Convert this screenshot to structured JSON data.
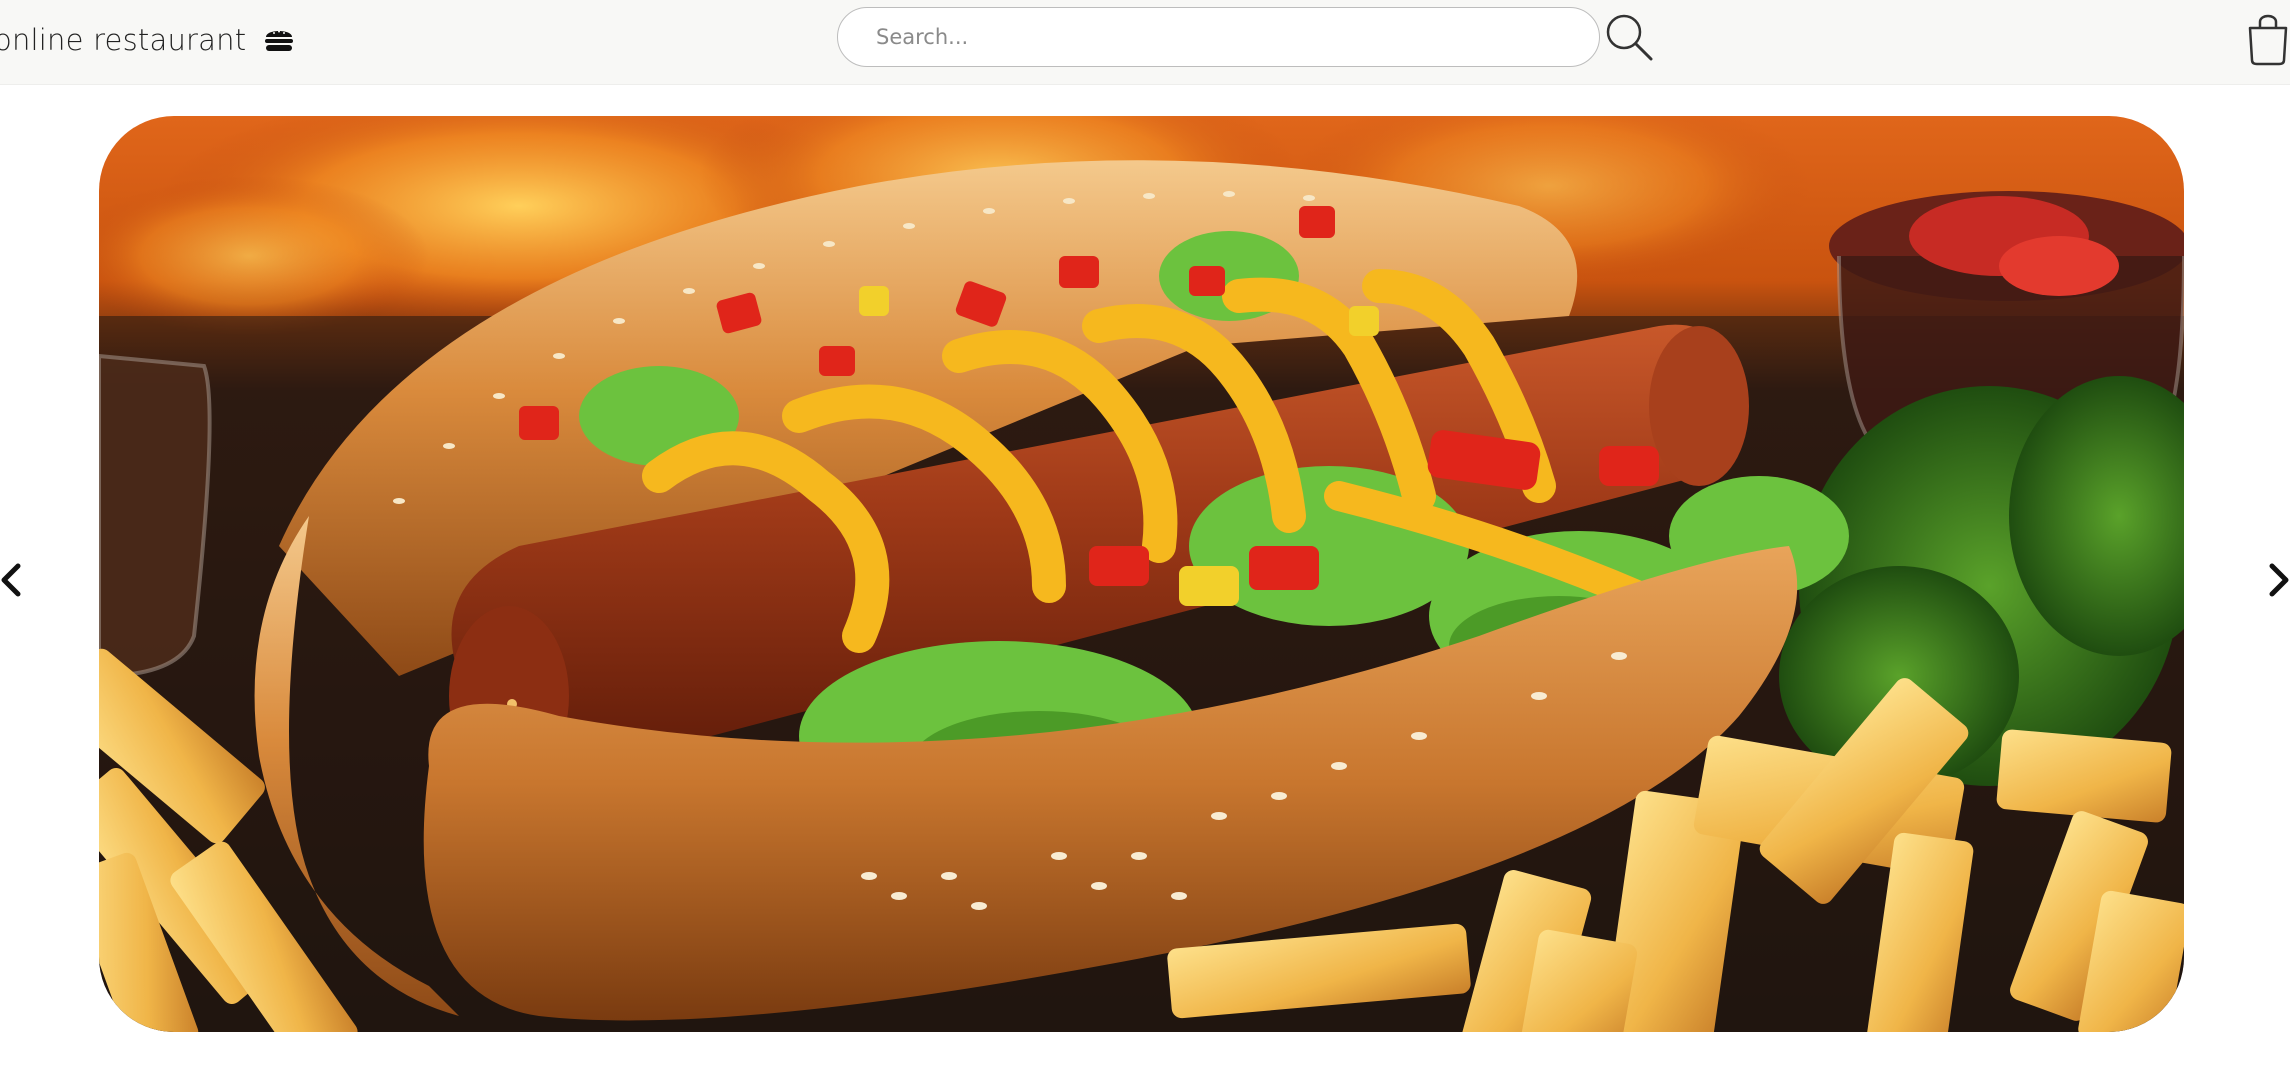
{
  "header": {
    "brand_name": "online restaurant",
    "brand_icon": "burger-icon",
    "search": {
      "placeholder": "Search...",
      "value": "",
      "button_icon": "search-icon"
    },
    "cart_icon": "shopping-bag-icon"
  },
  "carousel": {
    "slide_image": "hot-dog-with-fries",
    "slide_alt": "",
    "prev_icon": "chevron-left-icon",
    "next_icon": "chevron-right-icon"
  },
  "colors": {
    "header_bg": "#f8f8f6",
    "page_bg": "#ffffff",
    "text": "#222222",
    "search_border": "#bdbdbd"
  }
}
